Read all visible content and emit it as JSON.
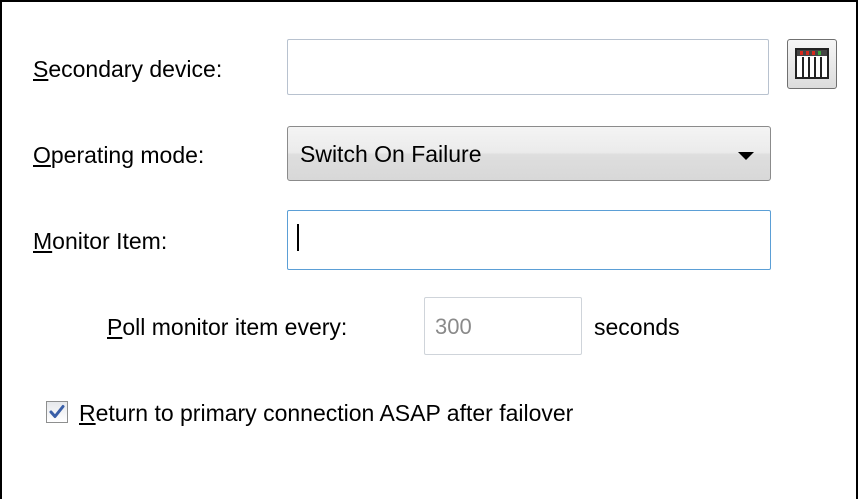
{
  "fields": {
    "secondary_device": {
      "label_mnemonic": "S",
      "label_rest": "econdary device:",
      "value": "",
      "browse_icon": "device-list-icon"
    },
    "operating_mode": {
      "label_mnemonic": "O",
      "label_rest": "perating mode:",
      "selected": "Switch On Failure",
      "icon": "chevron-down-icon"
    },
    "monitor_item": {
      "label_mnemonic": "M",
      "label_rest": "onitor Item:",
      "value": ""
    },
    "poll": {
      "label_mnemonic": "P",
      "label_rest": "oll monitor item every:",
      "value": "300",
      "unit": "seconds"
    },
    "return_primary": {
      "checked": true,
      "label_mnemonic": "R",
      "label_rest": "eturn to primary connection ASAP after failover"
    }
  },
  "colors": {
    "focus_border": "#5b9fd6",
    "input_border": "#b8c2cf",
    "check_mark": "#3a5fa8",
    "device_icon_red": "#d62a1e",
    "device_icon_green": "#3aa83a"
  }
}
